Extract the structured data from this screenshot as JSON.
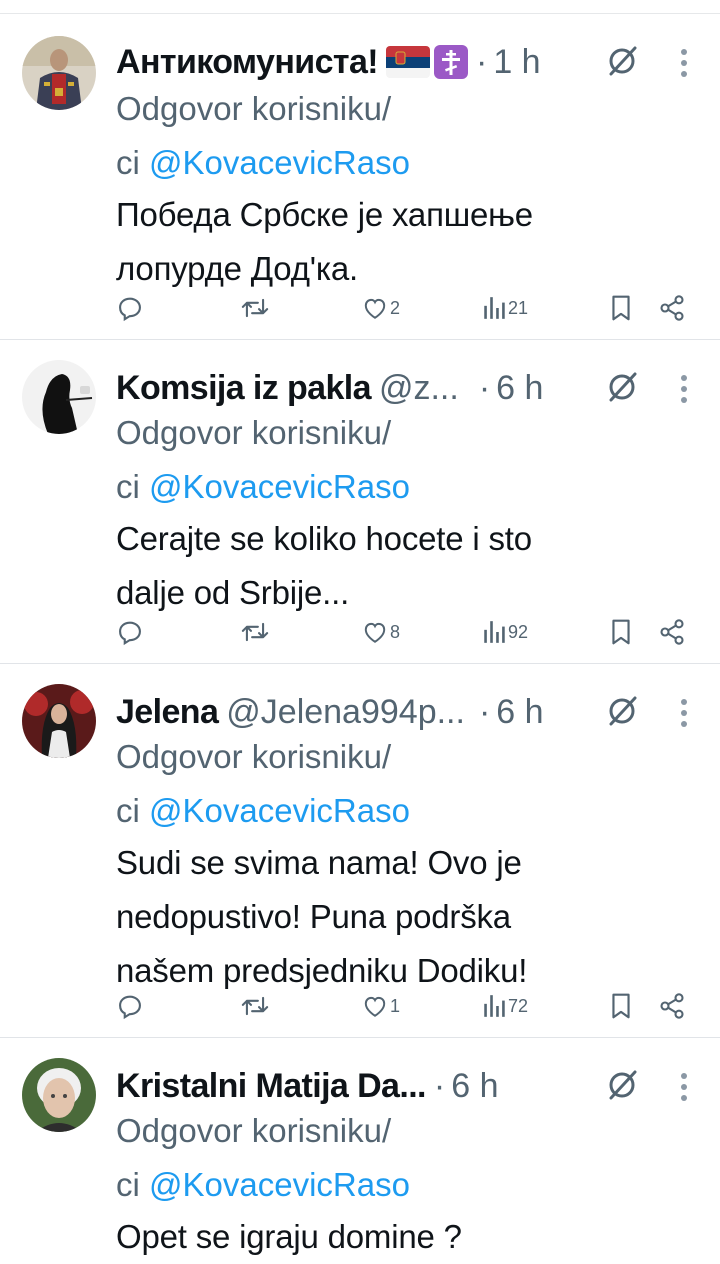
{
  "common": {
    "reply_prefix": "Odgovor korisniku/",
    "reply_prefix2": "ci",
    "mention": "@KovacevicRaso",
    "separator": "·"
  },
  "posts": [
    {
      "name": "Антикомуниста!",
      "handle": "",
      "time": "1 h",
      "text_lines": [
        "Победа Србске је хапшење",
        "лопурде Дод'ка."
      ],
      "likes": "2",
      "views": "21"
    },
    {
      "name": "Komsija iz pakla",
      "handle": "@z...",
      "time": "6 h",
      "text_lines": [
        "Cerajte se koliko hocete i sto",
        "dalje od Srbije..."
      ],
      "likes": "8",
      "views": "92"
    },
    {
      "name": "Jelena",
      "handle": "@Jelena994p...",
      "time": "6 h",
      "text_lines": [
        "Sudi se svima nama! Ovo je",
        "nedopustivo! Puna podrška",
        "našem predsjedniku Dodiku!"
      ],
      "likes": "1",
      "views": "72"
    },
    {
      "name": "Kristalni Matija Da...",
      "handle": "",
      "time": "6 h",
      "text_lines": [
        "Opet se igraju domine ?"
      ],
      "likes": "",
      "views": ""
    }
  ],
  "colors": {
    "secondary_text": "#536471",
    "mention": "#1d9bf0",
    "divider": "#e1e4e8",
    "serbia_red": "#c6363c",
    "serbia_blue": "#0c4076",
    "cross_bg": "#9b59c6"
  },
  "icons": [
    "reply-icon",
    "retweet-icon",
    "like-icon",
    "views-icon",
    "bookmark-icon",
    "share-icon",
    "grok-icon",
    "more-icon"
  ]
}
